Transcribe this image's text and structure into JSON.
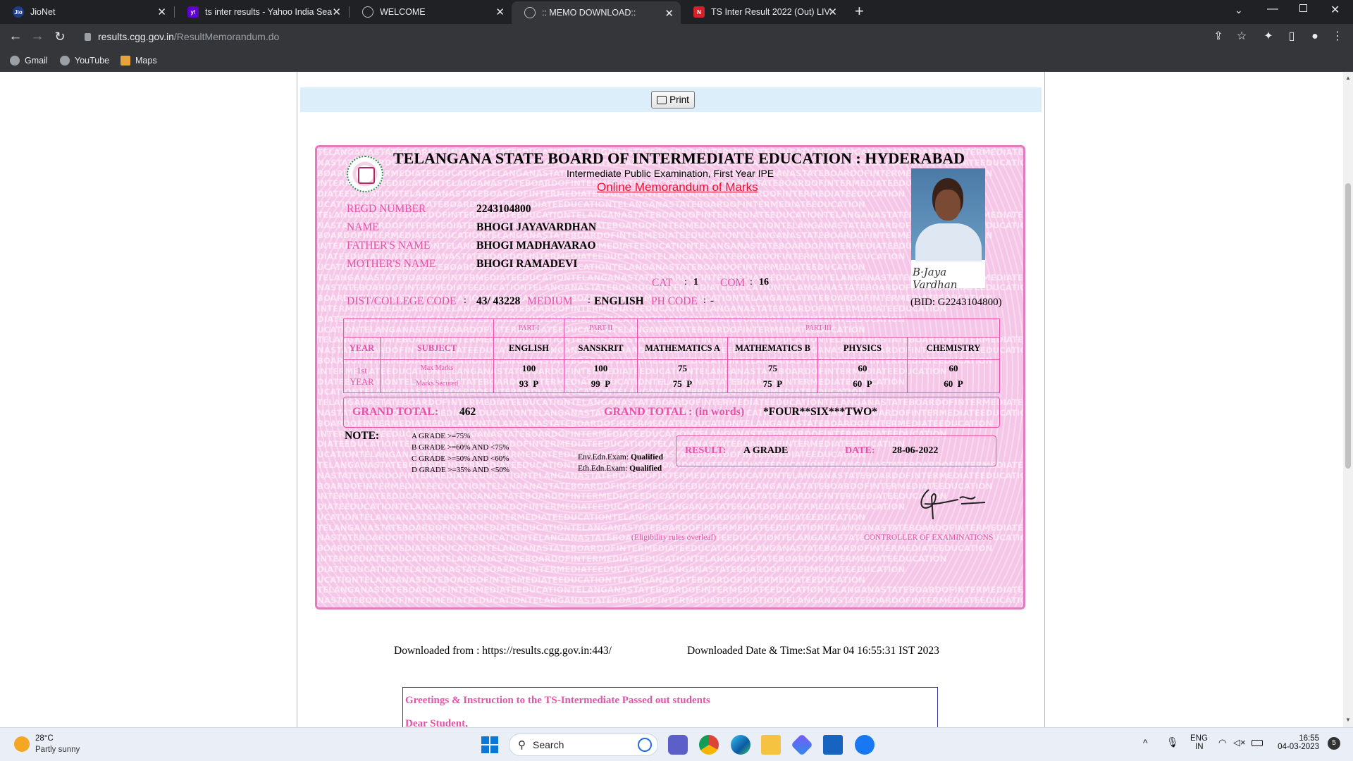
{
  "browser": {
    "tabs": [
      {
        "title": "JioNet",
        "favicon": "jio-icon"
      },
      {
        "title": "ts inter results - Yahoo India Sear",
        "favicon": "yahoo-icon"
      },
      {
        "title": "WELCOME",
        "favicon": "globe-icon"
      },
      {
        "title": ":: MEMO DOWNLOAD::",
        "favicon": "globe-icon"
      },
      {
        "title": "TS Inter Result 2022 (Out) LIVE: Ti",
        "favicon": "news-icon"
      }
    ],
    "active_tab_index": 3,
    "new_tab": "+",
    "url_host": "results.cgg.gov.in",
    "url_path": "/ResultMemorandum.do",
    "bookmarks": [
      "Gmail",
      "YouTube",
      "Maps"
    ]
  },
  "page": {
    "print_label": "Print",
    "memo": {
      "watermark_text": "TELANGANASTATEBOARDOFINTERMEDIATEEDUCATION",
      "board_title": "TELANGANA STATE BOARD OF INTERMEDIATE EDUCATION : HYDERABAD",
      "exam_title": "Intermediate Public Examination, First Year IPE",
      "memo_title": "Online Memorandum of Marks",
      "fields": {
        "regd_label": "REGD NUMBER",
        "regd_value": "2243104800",
        "name_label": "NAME",
        "name_value": "BHOGI JAYAVARDHAN",
        "father_label": "FATHER'S NAME",
        "father_value": "BHOGI MADHAVARAO",
        "mother_label": "MOTHER'S NAME",
        "mother_value": "BHOGI RAMADEVI",
        "cat_label": "CAT",
        "cat_value": "1",
        "com_label": "COM",
        "com_value": "16",
        "dist_label": "DIST/COLLEGE CODE",
        "dist_value": "43/ 43228",
        "medium_label": "MEDIUM",
        "medium_value": "ENGLISH",
        "ph_label": "PH CODE",
        "ph_value": "-",
        "bid": "(BID: G2243104800)",
        "photo_signature": "B·Jaya Vardhan"
      },
      "table": {
        "part1": "PART-I",
        "part2": "PART-II",
        "part3": "PART-III",
        "year_header": "YEAR",
        "subject_header": "SUBJECT",
        "year_value_1": "1st",
        "year_value_2": "YEAR",
        "max_label": "Max Marks",
        "secured_label": "Marks Secured",
        "subjects": [
          {
            "name": "ENGLISH",
            "max": "100",
            "secured": "93",
            "status": "P"
          },
          {
            "name": "SANSKRIT",
            "max": "100",
            "secured": "99",
            "status": "P"
          },
          {
            "name": "MATHEMATICS A",
            "max": "75",
            "secured": "75",
            "status": "P"
          },
          {
            "name": "MATHEMATICS B",
            "max": "75",
            "secured": "75",
            "status": "P"
          },
          {
            "name": "PHYSICS",
            "max": "60",
            "secured": "60",
            "status": "P"
          },
          {
            "name": "CHEMISTRY",
            "max": "60",
            "secured": "60",
            "status": "P"
          }
        ]
      },
      "grand_total_label": "GRAND TOTAL:",
      "grand_total_value": "462",
      "grand_total_words_label": "GRAND TOTAL : (in words)",
      "grand_total_words_value": "*FOUR**SIX***TWO*",
      "note_label": "NOTE:",
      "grades": [
        "A GRADE >=75%",
        "B GRADE >=60% AND <75%",
        "C GRADE >=50% AND <60%",
        "D GRADE >=35% AND <50%"
      ],
      "env_label": "Env.Edn.Exam:",
      "env_value": "Qualified",
      "eth_label": "Eth.Edn.Exam:",
      "eth_value": "Qualified",
      "result_label": "RESULT:",
      "result_value": "A GRADE",
      "date_label": "DATE:",
      "date_value": "28-06-2022",
      "eligibility": "(Eligibility rules overleaf)",
      "controller": "CONTROLLER OF EXAMINATIONS"
    },
    "downloaded_from": "Downloaded from : https://results.cgg.gov.in:443/",
    "downloaded_time": "Downloaded Date & Time:Sat Mar 04 16:55:31 IST 2023",
    "greeting_title": "Greetings & Instruction to the TS-Intermediate Passed out students",
    "greeting_dear": "Dear Student,"
  },
  "taskbar": {
    "weather_temp": "28°C",
    "weather_desc": "Partly sunny",
    "search_placeholder": "Search",
    "lang_1": "ENG",
    "lang_2": "IN",
    "time": "16:55",
    "date": "04-03-2023",
    "notification_count": "5"
  },
  "colors": {
    "memo_pink": "#f5c6e7",
    "memo_accent": "#e453a8",
    "chrome_dark": "#202124"
  }
}
